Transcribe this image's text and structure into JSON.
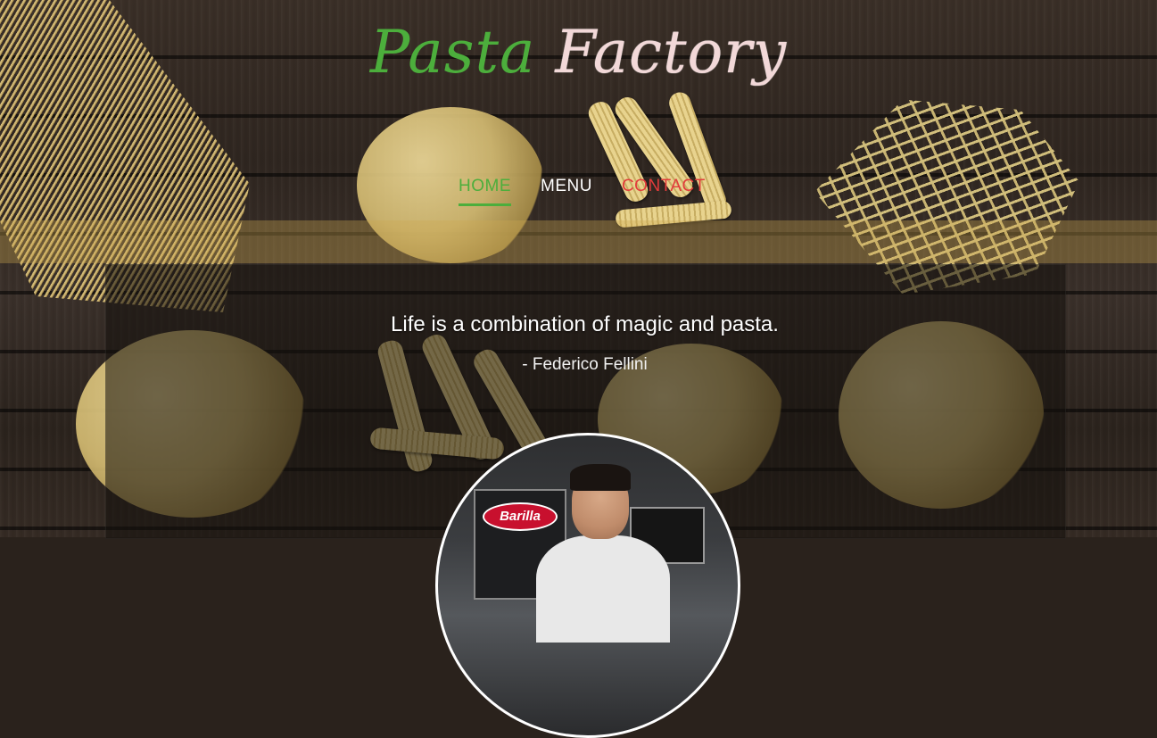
{
  "logo": {
    "word1": "Pasta",
    "word2": "Factory",
    "colors": {
      "green": "#4cae3c",
      "white": "#f2d8d8",
      "red": "#e23b3b"
    }
  },
  "nav": {
    "items": [
      {
        "label": "HOME",
        "active": true
      },
      {
        "label": "MENU",
        "active": false
      },
      {
        "label": "CONTACT",
        "active": false
      }
    ]
  },
  "hero": {
    "quote": "Life is a combination of magic and pasta.",
    "author": "- Federico Fellini"
  },
  "photo": {
    "pack_label": "Barilla"
  }
}
